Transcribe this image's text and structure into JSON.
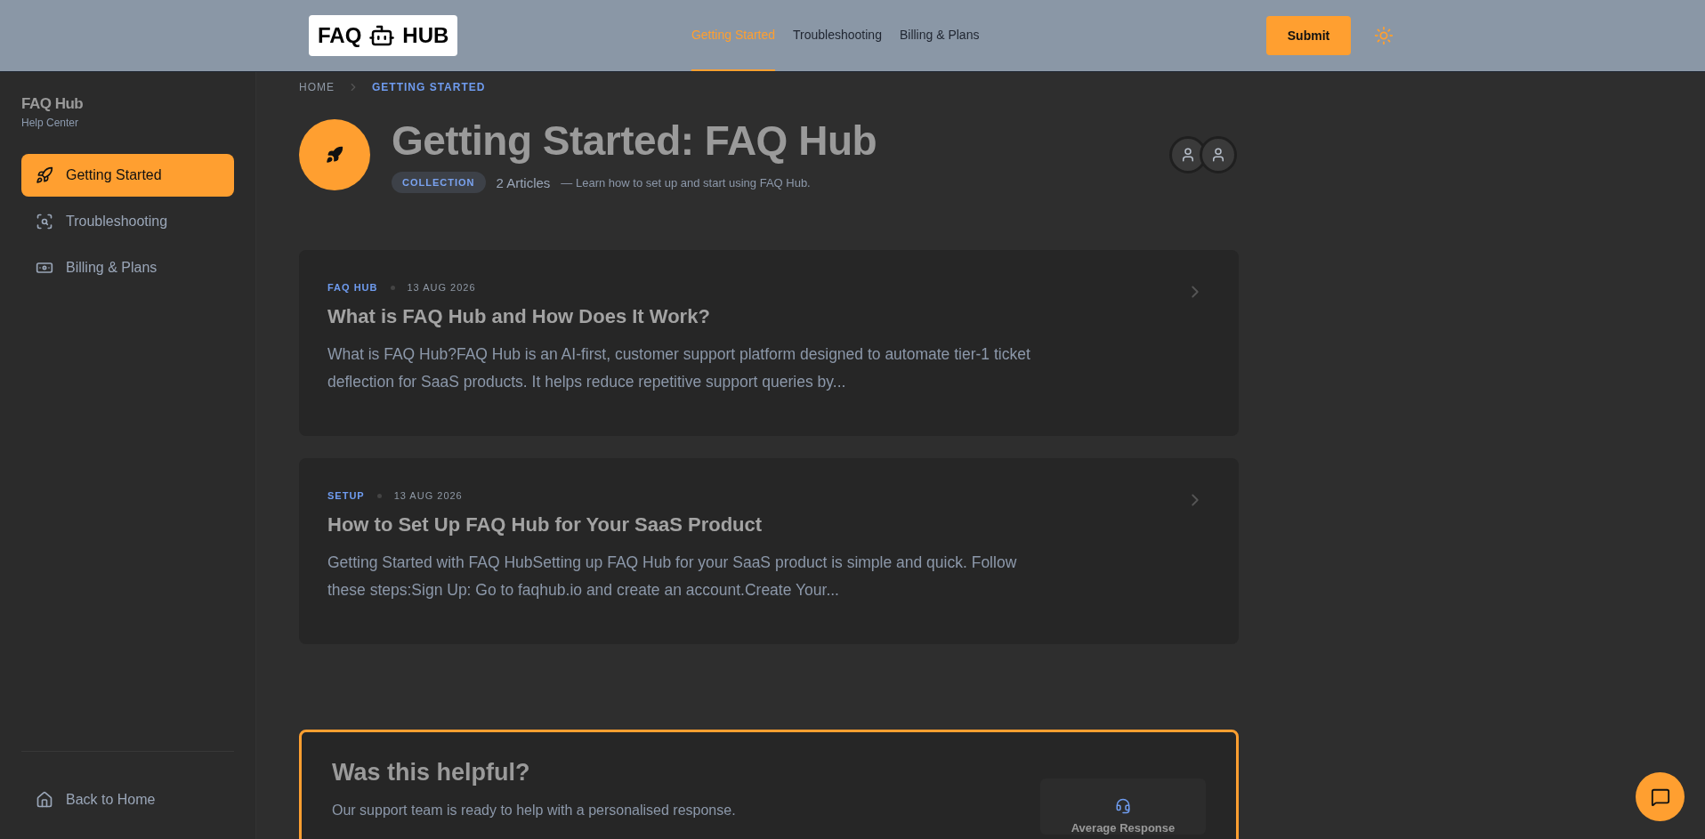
{
  "header": {
    "logo": {
      "left": "FAQ",
      "right": "HUB"
    },
    "nav": [
      {
        "label": "Getting Started",
        "selected": true
      },
      {
        "label": "Troubleshooting",
        "selected": false
      },
      {
        "label": "Billing & Plans",
        "selected": false
      }
    ],
    "submit": "Submit"
  },
  "sidebar": {
    "title": "FAQ Hub",
    "subtitle": "Help Center",
    "items": [
      {
        "label": "Getting Started",
        "kind": "rocket",
        "selected": true
      },
      {
        "label": "Troubleshooting",
        "kind": "search",
        "selected": false
      },
      {
        "label": "Billing & Plans",
        "kind": "money",
        "selected": false
      }
    ],
    "footer": "Back to Home"
  },
  "breadcrumb": [
    {
      "label": "HOME",
      "selected": false
    },
    {
      "label": "GETTING STARTED",
      "selected": true
    }
  ],
  "collection": {
    "title": "Getting Started: FAQ Hub",
    "tag": "COLLECTION",
    "count": "2 Articles",
    "description": "— Learn how to set up and start using FAQ Hub."
  },
  "articles": [
    {
      "category": "FAQ HUB",
      "date": "13 AUG 2026",
      "title": "What is FAQ Hub and How Does It Work?",
      "excerpt": "What is FAQ Hub?FAQ Hub is an AI-first, customer support platform designed to automate tier-1 ticket deflection for SaaS products. It helps reduce repetitive support queries by..."
    },
    {
      "category": "SETUP",
      "date": "13 AUG 2026",
      "title": "How to Set Up FAQ Hub for Your SaaS Product",
      "excerpt": "Getting Started with FAQ HubSetting up FAQ Hub for your SaaS product is simple and quick. Follow these steps:Sign Up: Go to faqhub.io and create an account.Create Your..."
    }
  ],
  "helpful": {
    "title": "Was this helpful?",
    "text": "Our support team is ready to help with a personalised response.",
    "stat_label": "Average Response"
  }
}
